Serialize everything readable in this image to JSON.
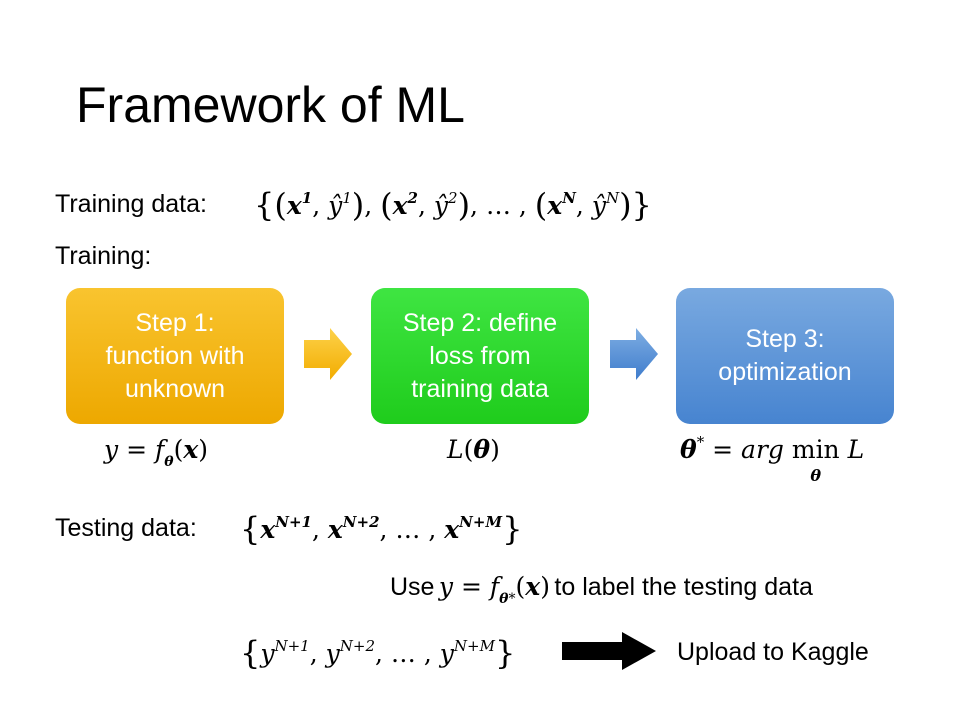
{
  "title": "Framework of ML",
  "training_data": {
    "label": "Training data:",
    "x_symbol": "x",
    "yhat_symbol": "ŷ",
    "sup_1": "1",
    "sup_2": "2",
    "sup_N": "N",
    "ellipsis": "…"
  },
  "training_label": "Training:",
  "steps": [
    {
      "label": "Step 1:\nfunction with\nunknown",
      "color": "#f5b800"
    },
    {
      "label": "Step 2: define\nloss from\ntraining data",
      "color": "#2dd92e"
    },
    {
      "label": "Step 3:\noptimization",
      "color": "#5b93d6"
    }
  ],
  "arrow_colors": {
    "arrow1": "#fbc000",
    "arrow2": "#4a88d5"
  },
  "formulas": {
    "step1": {
      "y": "y",
      "eq": "=",
      "f": "f",
      "theta": "θ",
      "x": "x"
    },
    "step2": {
      "L": "L",
      "theta": "θ"
    },
    "step3": {
      "theta": "θ",
      "star": "*",
      "eq": "=",
      "arg": "arg",
      "min": "min",
      "under": "θ",
      "L": "L"
    }
  },
  "testing_data": {
    "label": "Testing data:",
    "x_symbol": "x",
    "sup_1": "N+1",
    "sup_2": "N+2",
    "sup_M": "N+M",
    "ellipsis": "…"
  },
  "use_line": {
    "use": "Use",
    "y": "y",
    "eq": "=",
    "f": "f",
    "theta": "θ",
    "star": "*",
    "x": "x",
    "rest": "to label the testing data"
  },
  "output": {
    "y_symbol": "y",
    "sup_1": "N+1",
    "sup_2": "N+2",
    "sup_M": "N+M",
    "ellipsis": "…",
    "upload": "Upload to Kaggle"
  }
}
